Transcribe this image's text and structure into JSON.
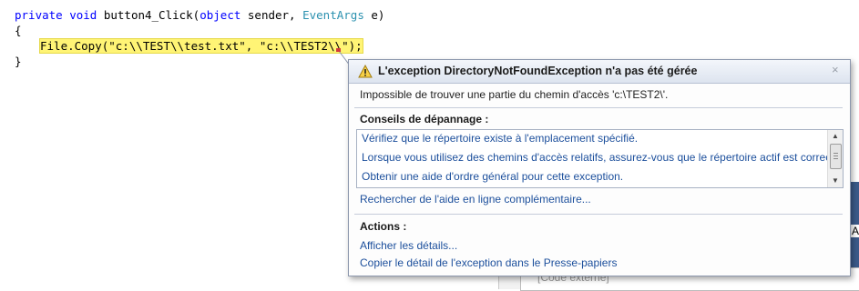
{
  "code": {
    "line1": {
      "kw_private": "private",
      "kw_void": "void",
      "method": " button4_Click(",
      "kw_object": "object",
      "param1": " sender, ",
      "type_eventargs": "EventArgs",
      "param2": " e)"
    },
    "line2": "{",
    "line3": "File.Copy(\"c:\\\\TEST\\\\test.txt\", \"c:\\\\TEST2\\\\\");",
    "line4": "}"
  },
  "exception": {
    "title": "L'exception DirectoryNotFoundException n'a pas été gérée",
    "message": "Impossible de trouver une partie du chemin d'accès 'c:\\TEST2\\'.",
    "tips_heading": "Conseils de dépannage :",
    "tips": [
      "Vérifiez que le répertoire existe à l'emplacement spécifié.",
      "Lorsque vous utilisez des chemins d'accès relatifs, assurez-vous que le répertoire actif est correct.",
      "Obtenir une aide d'ordre général pour cette exception."
    ],
    "search_online": "Rechercher de l'aide en ligne complémentaire...",
    "actions_heading": "Actions :",
    "actions": [
      "Afficher les détails...",
      "Copier le détail de l'exception dans le Presse-papiers"
    ],
    "close_glyph": "×"
  },
  "background": {
    "field_text": "[Code externe]",
    "edge_letter": "A"
  },
  "colors": {
    "keyword": "#0000ff",
    "type": "#2b91af",
    "string": "#a31515",
    "highlight": "#fff475",
    "link": "#1c4f9c"
  }
}
